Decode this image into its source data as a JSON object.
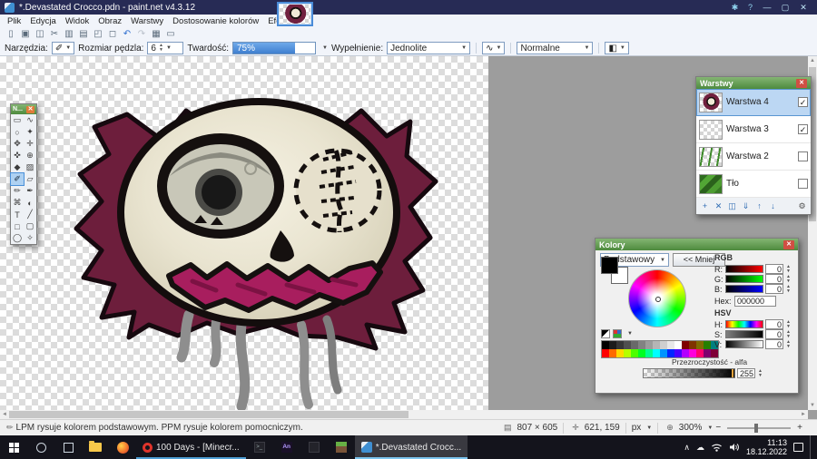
{
  "titlebar": {
    "title": "*.Devastated Crocco.pdn - paint.net v4.3.12",
    "settings_glyph": "✱",
    "help_glyph": "?",
    "minimize": "—",
    "maximize": "▢",
    "close": "✕"
  },
  "menubar": {
    "items": [
      "Plik",
      "Edycja",
      "Widok",
      "Obraz",
      "Warstwy",
      "Dostosowanie kolorów",
      "Efekty"
    ]
  },
  "toolbar": {
    "buttons": [
      {
        "name": "new-image",
        "glyph": "▯"
      },
      {
        "name": "open",
        "glyph": "▣"
      },
      {
        "name": "save",
        "glyph": "◫"
      },
      {
        "name": "cut",
        "glyph": "✂"
      },
      {
        "name": "copy",
        "glyph": "▥"
      },
      {
        "name": "paste",
        "glyph": "▤"
      },
      {
        "name": "crop-to-selection",
        "glyph": "◰"
      },
      {
        "name": "deselect",
        "glyph": "◻"
      },
      {
        "name": "undo",
        "glyph": "↶",
        "accent": true
      },
      {
        "name": "redo",
        "glyph": "↷",
        "disabled": true
      },
      {
        "name": "grid-toggle",
        "glyph": "▦"
      },
      {
        "name": "ruler-toggle",
        "glyph": "▭"
      }
    ]
  },
  "options": {
    "tools_label": "Narzędzia:",
    "tool_button_glyph": "✐",
    "size_label": "Rozmiar pędzla:",
    "size_value": "6",
    "hardness_label": "Twardość:",
    "hardness_value": "75%",
    "hardness_percent": 75,
    "fill_label": "Wypełnienie:",
    "fill_value": "Jednolite",
    "antialias_glyph": "∿",
    "blend_value": "Normalne",
    "sampling_glyph": "◧"
  },
  "tools_palette": {
    "title": "N...",
    "selected_index": 10,
    "tools": [
      {
        "name": "rectangle-select",
        "glyph": "▭"
      },
      {
        "name": "lasso-select",
        "glyph": "∿"
      },
      {
        "name": "ellipse-select",
        "glyph": "○"
      },
      {
        "name": "magic-wand",
        "glyph": "✦"
      },
      {
        "name": "pan",
        "glyph": "✥"
      },
      {
        "name": "move-selected-pixels",
        "glyph": "✛"
      },
      {
        "name": "move-selection",
        "glyph": "✜"
      },
      {
        "name": "zoom",
        "glyph": "⊕"
      },
      {
        "name": "paint-bucket",
        "glyph": "◆"
      },
      {
        "name": "gradient",
        "glyph": "▨"
      },
      {
        "name": "paintbrush",
        "glyph": "✐"
      },
      {
        "name": "eraser",
        "glyph": "▱"
      },
      {
        "name": "pencil",
        "glyph": "✏"
      },
      {
        "name": "color-picker",
        "glyph": "✒"
      },
      {
        "name": "clone-stamp",
        "glyph": "⌘"
      },
      {
        "name": "recolor",
        "glyph": "◐"
      },
      {
        "name": "text",
        "glyph": "T"
      },
      {
        "name": "line-curve",
        "glyph": "╱"
      },
      {
        "name": "rectangle",
        "glyph": "□"
      },
      {
        "name": "rounded-rectangle",
        "glyph": "▢"
      },
      {
        "name": "ellipse",
        "glyph": "◯"
      },
      {
        "name": "freeform-shape",
        "glyph": "✧"
      }
    ]
  },
  "layers": {
    "title": "Warstwy",
    "rows": [
      {
        "name": "Warstwa 4",
        "checked": true,
        "selected": true,
        "thumb": "face"
      },
      {
        "name": "Warstwa 3",
        "checked": true,
        "selected": false,
        "thumb": "empty"
      },
      {
        "name": "Warstwa 2",
        "checked": false,
        "selected": false,
        "thumb": "grass-sparse"
      },
      {
        "name": "Tło",
        "checked": false,
        "selected": false,
        "thumb": "grass"
      }
    ],
    "toolbar": [
      {
        "name": "add-layer",
        "glyph": "+"
      },
      {
        "name": "delete-layer",
        "glyph": "✕"
      },
      {
        "name": "duplicate-layer",
        "glyph": "◫"
      },
      {
        "name": "merge-layer-down",
        "glyph": "⇓"
      },
      {
        "name": "move-layer-up",
        "glyph": "↑"
      },
      {
        "name": "move-layer-down",
        "glyph": "↓"
      },
      {
        "name": "layer-properties",
        "glyph": "⚙",
        "right": true
      }
    ]
  },
  "colors": {
    "title": "Kolory",
    "mode": "Podstawowy",
    "less_button": "<< Mniej",
    "rgb_label": "RGB",
    "hsv_label": "HSV",
    "hex_label": "Hex:",
    "hex_value": "000000",
    "alpha_label": "Przezroczystość - alfa",
    "alpha_value": "255",
    "rgb_channels": [
      {
        "name": "red",
        "label": "R:",
        "value": "0",
        "grad": "red"
      },
      {
        "name": "green",
        "label": "G:",
        "value": "0",
        "grad": "green"
      },
      {
        "name": "blue",
        "label": "B:",
        "value": "0",
        "grad": "blue"
      }
    ],
    "hsv_channels": [
      {
        "name": "hue",
        "label": "H:",
        "value": "0",
        "grad": "hue"
      },
      {
        "name": "saturation",
        "label": "S:",
        "value": "0",
        "grad": "sat"
      },
      {
        "name": "value",
        "label": "V:",
        "value": "0",
        "grad": "val"
      }
    ],
    "palette": [
      "#000000",
      "#1c1c1c",
      "#363636",
      "#4f4f4f",
      "#696969",
      "#828282",
      "#9c9c9c",
      "#b5b5b5",
      "#cfcfcf",
      "#e8e8e8",
      "#ffffff",
      "#7f0000",
      "#7f3300",
      "#7f6a00",
      "#267f00",
      "#007f7f",
      "#ff0000",
      "#ff6a00",
      "#ffd800",
      "#b6ff00",
      "#4cff00",
      "#00ff21",
      "#00ff90",
      "#00ffff",
      "#0094ff",
      "#0026ff",
      "#4800ff",
      "#b200ff",
      "#ff00dc",
      "#ff006e",
      "#7f006e",
      "#7f0037"
    ]
  },
  "statusbar": {
    "hint": "LPM rysuje kolorem podstawowym. PPM rysuje kolorem pomocniczym.",
    "image_size": "807 × 605",
    "cursor_position": "621, 159",
    "units": "px",
    "zoom": "300%"
  },
  "taskbar": {
    "apps": [
      {
        "label": "100 Days - [Minecr..."
      },
      {
        "label": "*.Devastated Crocc..."
      }
    ],
    "clock": {
      "time": "11:13",
      "date": "18.12.2022"
    }
  }
}
